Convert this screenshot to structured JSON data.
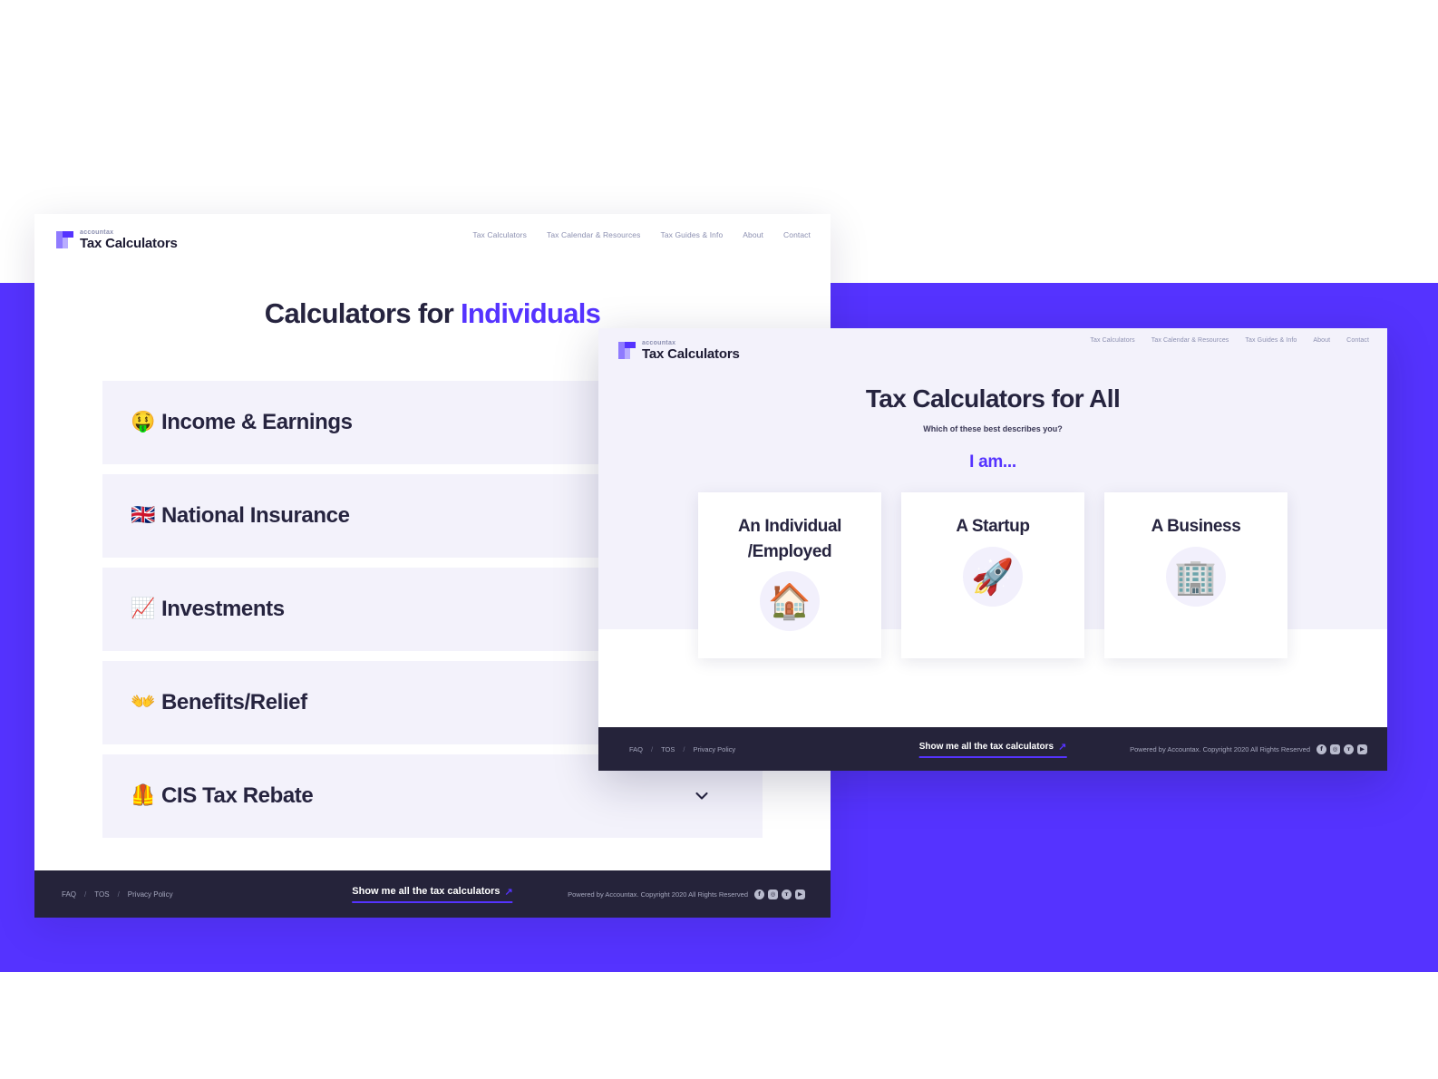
{
  "brand": {
    "sup": "accountax",
    "name": "Tax Calculators",
    "logo_icon": "accountax-t-logo-icon",
    "accent_color": "#5533ff"
  },
  "backdrop": {
    "color": "#5533ff"
  },
  "nav": {
    "items": [
      {
        "label": "Tax Calculators"
      },
      {
        "label": "Tax Calendar & Resources"
      },
      {
        "label": "Tax Guides & Info"
      },
      {
        "label": "About"
      },
      {
        "label": "Contact"
      }
    ]
  },
  "back_window": {
    "title_plain": "Calculators for ",
    "title_accent": "Individuals",
    "calculators": [
      {
        "emoji": "🤑",
        "icon_name": "money-mouth-face-icon",
        "label": "Income & Earnings",
        "chevron": false
      },
      {
        "emoji": "🇬🇧",
        "icon_name": "uk-flag-icon",
        "label": "National Insurance",
        "chevron": false
      },
      {
        "emoji": "📈",
        "icon_name": "chart-increasing-icon",
        "label": "Investments",
        "chevron": false
      },
      {
        "emoji": "👐",
        "icon_name": "open-hands-icon",
        "label": "Benefits/Relief",
        "chevron": false
      },
      {
        "emoji": "🦺",
        "icon_name": "safety-vest-icon",
        "label": "CIS Tax Rebate",
        "chevron": true
      }
    ]
  },
  "front_window": {
    "title": "Tax Calculators for All",
    "subtitle": "Which of these best describes you?",
    "prompt": "I am...",
    "options": [
      {
        "title": "An Individual\n/Employed",
        "emoji": "🏠",
        "icon_name": "house-icon"
      },
      {
        "title": "A Startup",
        "emoji": "🚀",
        "icon_name": "rocket-icon"
      },
      {
        "title": "A Business",
        "emoji": "🏢",
        "icon_name": "office-building-icon"
      }
    ]
  },
  "footer": {
    "links": [
      {
        "label": "FAQ"
      },
      {
        "label": "TOS"
      },
      {
        "label": "Privacy Policy"
      }
    ],
    "separator": "/",
    "cta_label": "Show me all the tax calculators",
    "cta_arrow": "↗",
    "copyright": "Powered by Accountax. Copyright 2020 All Rights Reserved",
    "socials": [
      {
        "name": "facebook-icon",
        "glyph": "f"
      },
      {
        "name": "instagram-icon",
        "glyph": "◎"
      },
      {
        "name": "twitter-icon",
        "glyph": "ᴛ"
      },
      {
        "name": "youtube-icon",
        "glyph": "▶"
      }
    ]
  }
}
